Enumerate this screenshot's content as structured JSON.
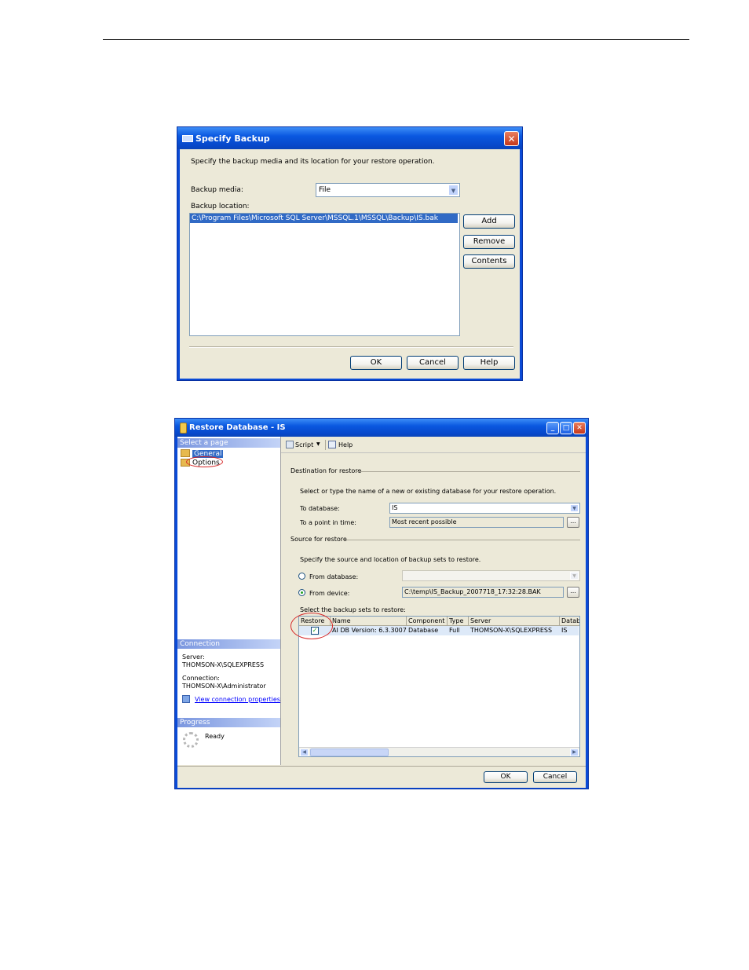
{
  "specify_backup": {
    "title": "Specify Backup",
    "instruction": "Specify the backup media and its location for your restore operation.",
    "backup_media_label": "Backup media:",
    "backup_media_value": "File",
    "backup_location_label": "Backup location:",
    "backup_locations": [
      "C:\\Program Files\\Microsoft SQL Server\\MSSQL.1\\MSSQL\\Backup\\IS.bak"
    ],
    "buttons": {
      "add": "Add",
      "remove": "Remove",
      "contents": "Contents",
      "ok": "OK",
      "cancel": "Cancel",
      "help": "Help"
    },
    "close_glyph": "✕"
  },
  "restore_database": {
    "title": "Restore Database - IS",
    "select_page_header": "Select a page",
    "pages": [
      "General",
      "Options"
    ],
    "connection_header": "Connection",
    "server_label": "Server:",
    "server_value": "THOMSON-X\\SQLEXPRESS",
    "connection_label": "Connection:",
    "connection_value": "THOMSON-X\\Administrator",
    "view_connection_link": "View connection properties",
    "progress_header": "Progress",
    "progress_status": "Ready",
    "toolbar": {
      "script": "Script",
      "help": "Help"
    },
    "destination_group": "Destination for restore",
    "destination_instruction": "Select or type the name of a new or existing database for your restore operation.",
    "to_database_label": "To database:",
    "to_database_value": "IS",
    "to_point_label": "To a point in time:",
    "to_point_value": "Most recent possible",
    "ellipsis": "...",
    "source_group": "Source for restore",
    "source_instruction": "Specify the source and location of backup sets to restore.",
    "from_database_label": "From database:",
    "from_device_label": "From device:",
    "from_device_value": "C:\\temp\\IS_Backup_2007718_17:32:28.BAK",
    "backup_sets_label": "Select the backup sets to restore:",
    "grid_columns": [
      "Restore",
      "Name",
      "Component",
      "Type",
      "Server",
      "Datab"
    ],
    "grid_rows": [
      {
        "name": "AI DB Version: 6.3.3007",
        "component": "Database",
        "type": "Full",
        "server": "THOMSON-X\\SQLEXPRESS",
        "database": "IS",
        "restore_checked": true
      }
    ],
    "check_glyph": "✓",
    "buttons": {
      "ok": "OK",
      "cancel": "Cancel"
    },
    "win_buttons": {
      "minimize": "_",
      "maximize": "□",
      "close": "✕"
    }
  }
}
